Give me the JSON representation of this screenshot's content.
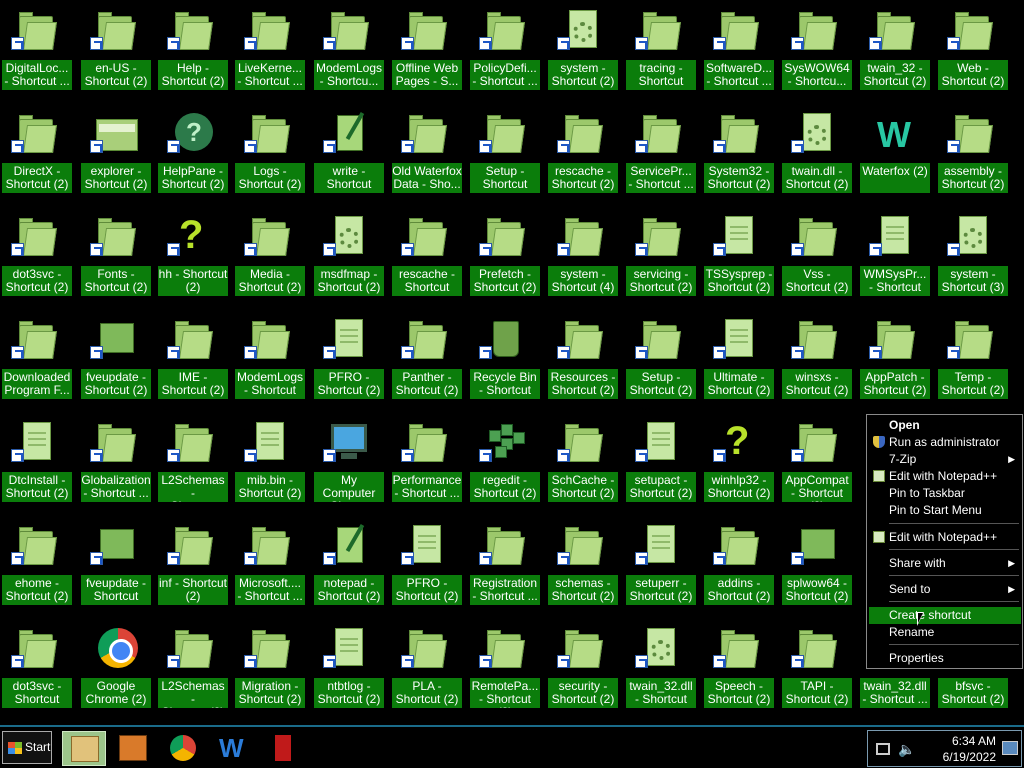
{
  "desktop": {
    "icons": [
      [
        {
          "label": "DigitalLoc...\n- Shortcut ...",
          "type": "folder"
        },
        {
          "label": "en-US -\nShortcut (2)",
          "type": "folder"
        },
        {
          "label": "Help -\nShortcut (2)",
          "type": "folder"
        },
        {
          "label": "LiveKerne...\n- Shortcut ...",
          "type": "folder"
        },
        {
          "label": "ModemLogs\n- Shortcu...",
          "type": "folder"
        },
        {
          "label": "Offline Web\nPages - S...",
          "type": "folder"
        },
        {
          "label": "PolicyDefi...\n- Shortcut ...",
          "type": "folder"
        },
        {
          "label": "system -\nShortcut (2)",
          "type": "gear"
        },
        {
          "label": "tracing -\nShortcut",
          "type": "folder"
        },
        {
          "label": "SoftwareD...\n- Shortcut ...",
          "type": "folder"
        },
        {
          "label": "SysWOW64\n- Shortcu...",
          "type": "folder"
        },
        {
          "label": "twain_32 -\nShortcut (2)",
          "type": "folder"
        },
        {
          "label": "Web -\nShortcut (2)",
          "type": "folder"
        }
      ],
      [
        {
          "label": "DirectX -\nShortcut (2)",
          "type": "folder"
        },
        {
          "label": "explorer -\nShortcut (2)",
          "type": "explorer"
        },
        {
          "label": "HelpPane -\nShortcut (2)",
          "type": "help"
        },
        {
          "label": "Logs -\nShortcut (2)",
          "type": "folder"
        },
        {
          "label": "write -\nShortcut",
          "type": "notepad"
        },
        {
          "label": "Old Waterfox\nData - Sho...",
          "type": "folder"
        },
        {
          "label": "Setup -\nShortcut",
          "type": "folder"
        },
        {
          "label": "rescache -\nShortcut (2)",
          "type": "folder"
        },
        {
          "label": "ServicePr...\n- Shortcut ...",
          "type": "folder"
        },
        {
          "label": "System32 -\nShortcut (2)",
          "type": "folder"
        },
        {
          "label": "twain.dll -\nShortcut (2)",
          "type": "gear"
        },
        {
          "label": "Waterfox (2)",
          "type": "waterfox"
        },
        {
          "label": "assembly -\nShortcut (2)",
          "type": "folder"
        }
      ],
      [
        {
          "label": "dot3svc -\nShortcut (2)",
          "type": "folder"
        },
        {
          "label": "Fonts -\nShortcut (2)",
          "type": "folder"
        },
        {
          "label": "hh - Shortcut\n(2)",
          "type": "qmark"
        },
        {
          "label": "Media -\nShortcut (2)",
          "type": "folder"
        },
        {
          "label": "msdfmap -\nShortcut (2)",
          "type": "gear"
        },
        {
          "label": "rescache -\nShortcut",
          "type": "folder"
        },
        {
          "label": "Prefetch -\nShortcut (2)",
          "type": "folder"
        },
        {
          "label": "system -\nShortcut (4)",
          "type": "folder"
        },
        {
          "label": "servicing -\nShortcut (2)",
          "type": "folder"
        },
        {
          "label": "TSSysprep -\nShortcut (2)",
          "type": "file"
        },
        {
          "label": "Vss -\nShortcut (2)",
          "type": "folder"
        },
        {
          "label": "WMSysPr...\n- Shortcut",
          "type": "file"
        },
        {
          "label": "system -\nShortcut (3)",
          "type": "gear"
        }
      ],
      [
        {
          "label": "Downloaded\nProgram F...",
          "type": "folder"
        },
        {
          "label": "fveupdate -\nShortcut (2)",
          "type": "app"
        },
        {
          "label": "IME -\nShortcut (2)",
          "type": "folder"
        },
        {
          "label": "ModemLogs\n- Shortcut",
          "type": "folder"
        },
        {
          "label": "PFRO -\nShortcut (2)",
          "type": "file"
        },
        {
          "label": "Panther -\nShortcut (2)",
          "type": "folder"
        },
        {
          "label": "Recycle Bin\n- Shortcut",
          "type": "recycle"
        },
        {
          "label": "Resources -\nShortcut (2)",
          "type": "folder"
        },
        {
          "label": "Setup -\nShortcut (2)",
          "type": "folder"
        },
        {
          "label": "Ultimate -\nShortcut (2)",
          "type": "file"
        },
        {
          "label": "winsxs -\nShortcut (2)",
          "type": "folder"
        },
        {
          "label": "AppPatch -\nShortcut (2)",
          "type": "folder"
        },
        {
          "label": "Temp -\nShortcut (2)",
          "type": "folder"
        }
      ],
      [
        {
          "label": "DtcInstall -\nShortcut (2)",
          "type": "file"
        },
        {
          "label": "Globalization\n- Shortcut ...",
          "type": "folder"
        },
        {
          "label": "L2Schemas -\nShortcut",
          "type": "folder"
        },
        {
          "label": "mib.bin -\nShortcut (2)",
          "type": "file"
        },
        {
          "label": "My Computer\n- Shortcut",
          "type": "monitor"
        },
        {
          "label": "Performance\n- Shortcut ...",
          "type": "folder"
        },
        {
          "label": "regedit -\nShortcut (2)",
          "type": "regedit"
        },
        {
          "label": "SchCache -\nShortcut (2)",
          "type": "folder"
        },
        {
          "label": "setupact -\nShortcut (2)",
          "type": "file"
        },
        {
          "label": "winhlp32 -\nShortcut (2)",
          "type": "qmark"
        },
        {
          "label": "AppCompat\n- Shortcut (2)",
          "type": "folder"
        }
      ],
      [
        {
          "label": "ehome -\nShortcut (2)",
          "type": "folder"
        },
        {
          "label": "fveupdate -\nShortcut",
          "type": "app"
        },
        {
          "label": "inf - Shortcut\n(2)",
          "type": "folder"
        },
        {
          "label": "Microsoft....\n- Shortcut ...",
          "type": "folder"
        },
        {
          "label": "notepad -\nShortcut (2)",
          "type": "notepad"
        },
        {
          "label": "PFRO -\nShortcut (2)",
          "type": "file"
        },
        {
          "label": "Registration\n- Shortcut ...",
          "type": "folder"
        },
        {
          "label": "schemas -\nShortcut (2)",
          "type": "folder"
        },
        {
          "label": "setuperr -\nShortcut (2)",
          "type": "file"
        },
        {
          "label": "addins -\nShortcut (2)",
          "type": "folder"
        },
        {
          "label": "splwow64 -\nShortcut (2)",
          "type": "app"
        }
      ],
      [
        {
          "label": "dot3svc -\nShortcut",
          "type": "folder"
        },
        {
          "label": "Google\nChrome (2)",
          "type": "chrome"
        },
        {
          "label": "L2Schemas -\nShortcut (2)",
          "type": "folder"
        },
        {
          "label": "Migration -\nShortcut (2)",
          "type": "folder"
        },
        {
          "label": "ntbtlog -\nShortcut (2)",
          "type": "file"
        },
        {
          "label": "PLA -\nShortcut (2)",
          "type": "folder"
        },
        {
          "label": "RemotePa...\n- Shortcut (2)",
          "type": "folder"
        },
        {
          "label": "security -\nShortcut (2)",
          "type": "folder"
        },
        {
          "label": "twain_32.dll\n- Shortcut",
          "type": "gear"
        },
        {
          "label": "Speech -\nShortcut (2)",
          "type": "folder"
        },
        {
          "label": "TAPI -\nShortcut (2)",
          "type": "folder"
        },
        {
          "label": "twain_32.dll\n- Shortcut ...",
          "type": "folder"
        },
        {
          "label": "bfsvc -\nShortcut (2)",
          "type": "folder"
        }
      ]
    ]
  },
  "context_menu": {
    "items": [
      {
        "label": "Open",
        "bold": true,
        "icon": "",
        "submenu": false
      },
      {
        "label": "Run as administrator",
        "bold": false,
        "icon": "shield-icon",
        "submenu": false
      },
      {
        "label": "7-Zip",
        "bold": false,
        "icon": "",
        "submenu": true
      },
      {
        "label": "Edit with Notepad++",
        "bold": false,
        "icon": "notepad-plus-icon",
        "submenu": false
      },
      {
        "label": "Pin to Taskbar",
        "bold": false,
        "icon": "",
        "submenu": false
      },
      {
        "label": "Pin to Start Menu",
        "bold": false,
        "icon": "",
        "submenu": false
      },
      {
        "label": "Edit with Notepad++",
        "bold": false,
        "icon": "notepad-plus-icon",
        "submenu": false
      },
      {
        "label": "Share with",
        "bold": false,
        "icon": "",
        "submenu": true
      },
      {
        "label": "Send to",
        "bold": false,
        "icon": "",
        "submenu": true
      },
      {
        "label": "Create shortcut",
        "bold": false,
        "icon": "",
        "submenu": false,
        "highlighted": true
      },
      {
        "label": "Rename",
        "bold": false,
        "icon": "",
        "submenu": false
      },
      {
        "label": "Properties",
        "bold": false,
        "icon": "",
        "submenu": false
      }
    ]
  },
  "taskbar": {
    "start_label": "Start",
    "pinned": [
      {
        "name": "windows-explorer-icon",
        "active": true
      },
      {
        "name": "media-player-icon",
        "active": false
      },
      {
        "name": "chrome-icon",
        "active": false
      },
      {
        "name": "waterfox-icon",
        "active": false
      },
      {
        "name": "app-icon",
        "active": false
      }
    ],
    "clock_time": "6:34 AM",
    "clock_date": "6/19/2022"
  },
  "colors": {
    "label_background": "#0b7d0b",
    "highlight": "#0b7d0b",
    "desktop_background": "#000000"
  }
}
